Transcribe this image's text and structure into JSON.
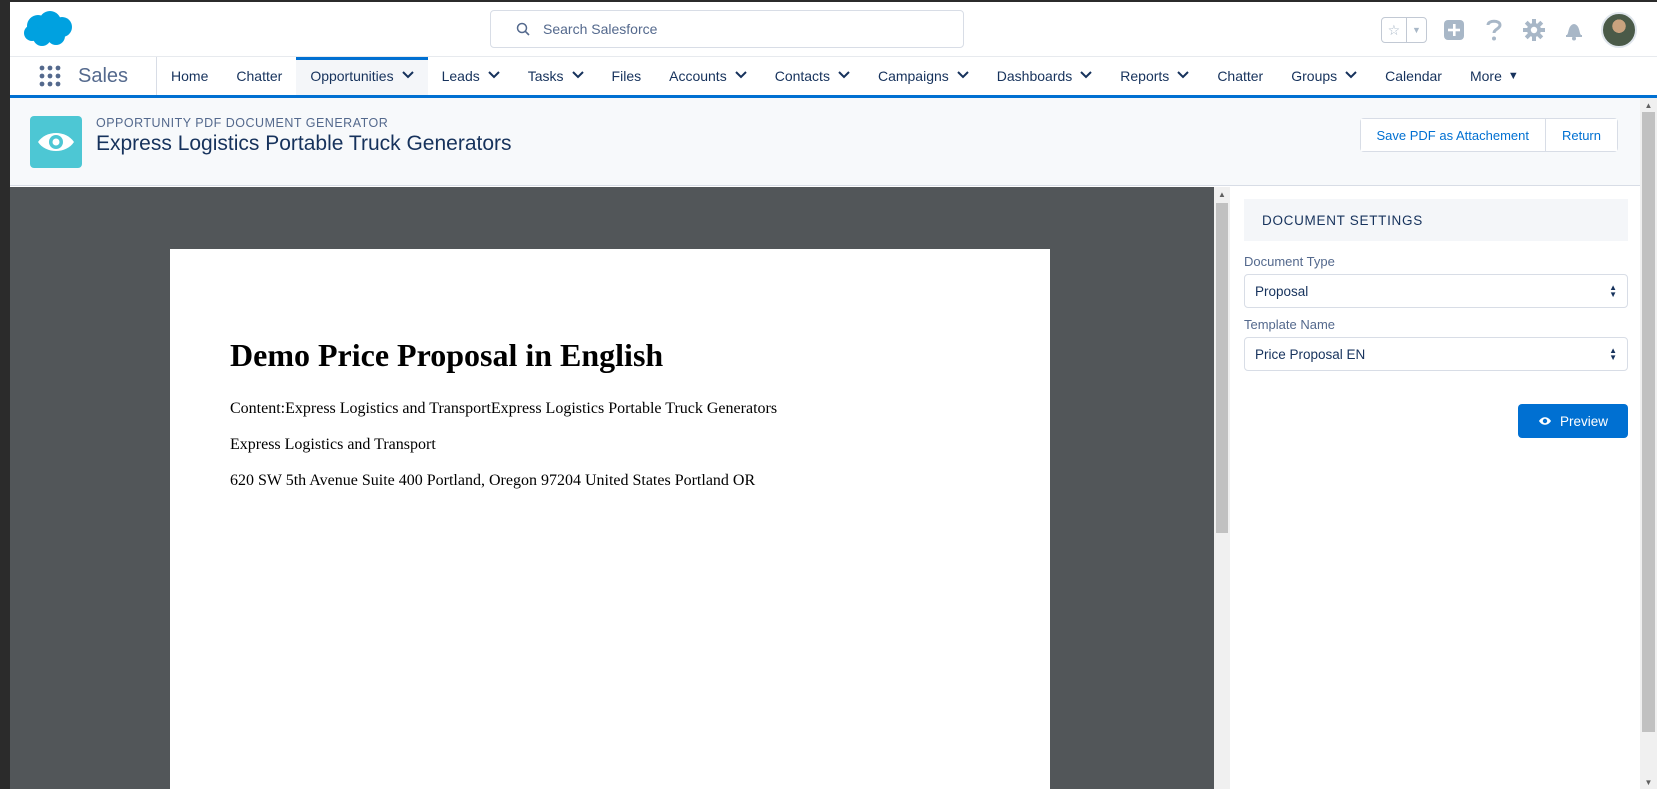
{
  "global_header": {
    "search_placeholder": "Search Salesforce",
    "icons": [
      "favorites-star-icon",
      "add-icon",
      "help-icon",
      "setup-gear-icon",
      "notifications-bell-icon",
      "user-avatar"
    ]
  },
  "nav": {
    "app_name": "Sales",
    "items": [
      {
        "label": "Home",
        "chevron": false
      },
      {
        "label": "Chatter",
        "chevron": false
      },
      {
        "label": "Opportunities",
        "chevron": true,
        "active": true
      },
      {
        "label": "Leads",
        "chevron": true
      },
      {
        "label": "Tasks",
        "chevron": true
      },
      {
        "label": "Files",
        "chevron": false
      },
      {
        "label": "Accounts",
        "chevron": true
      },
      {
        "label": "Contacts",
        "chevron": true
      },
      {
        "label": "Campaigns",
        "chevron": true
      },
      {
        "label": "Dashboards",
        "chevron": true
      },
      {
        "label": "Reports",
        "chevron": true
      },
      {
        "label": "Chatter",
        "chevron": false
      },
      {
        "label": "Groups",
        "chevron": true
      },
      {
        "label": "Calendar",
        "chevron": false
      }
    ],
    "more_label": "More"
  },
  "page_header": {
    "subtitle": "OPPORTUNITY PDF DOCUMENT GENERATOR",
    "title": "Express Logistics Portable Truck Generators",
    "save_label": "Save PDF as Attachement",
    "return_label": "Return"
  },
  "document": {
    "heading": "Demo Price Proposal in English",
    "content_line": "Content:Express Logistics and TransportExpress Logistics Portable Truck Generators",
    "company": "Express Logistics and Transport",
    "address": "620 SW 5th Avenue Suite 400 Portland, Oregon 97204 United States Portland OR"
  },
  "settings": {
    "heading": "DOCUMENT SETTINGS",
    "doc_type_label": "Document Type",
    "doc_type_value": "Proposal",
    "template_label": "Template Name",
    "template_value": "Price Proposal EN",
    "preview_label": "Preview"
  },
  "colors": {
    "brand": "#0070d2",
    "object_icon": "#4dc7d4",
    "viewer_bg": "#525659"
  }
}
